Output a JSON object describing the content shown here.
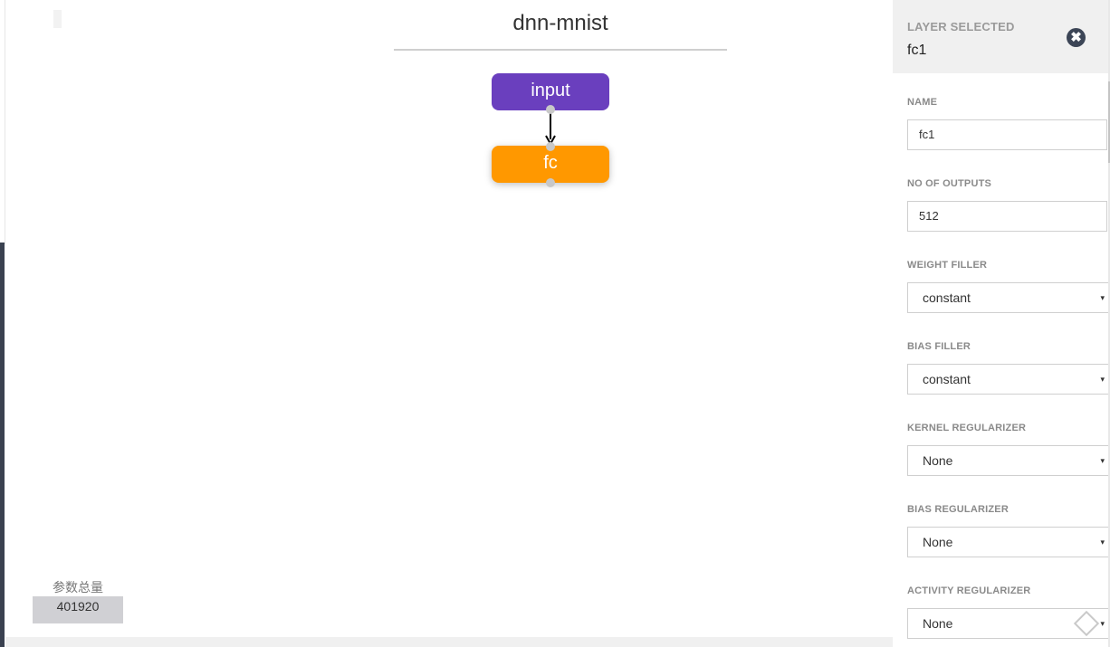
{
  "canvas": {
    "title": "dnn-mnist",
    "nodes": [
      {
        "label": "input",
        "color": "#6a3fbe"
      },
      {
        "label": "fc",
        "color": "#ff9800"
      }
    ],
    "params_label": "参数总量",
    "params_value": "401920"
  },
  "panel": {
    "header_label": "LAYER SELECTED",
    "header_value": "fc1",
    "close_icon": "close-circle-icon",
    "fields": [
      {
        "label": "NAME",
        "value": "fc1",
        "kind": "input"
      },
      {
        "label": "NO OF OUTPUTS",
        "value": "512",
        "kind": "input"
      },
      {
        "label": "WEIGHT FILLER",
        "value": "constant",
        "kind": "select"
      },
      {
        "label": "BIAS FILLER",
        "value": "constant",
        "kind": "select"
      },
      {
        "label": "KERNEL REGULARIZER",
        "value": "None",
        "kind": "select"
      },
      {
        "label": "BIAS REGULARIZER",
        "value": "None",
        "kind": "select"
      },
      {
        "label": "ACTIVITY REGULARIZER",
        "value": "None",
        "kind": "select"
      }
    ],
    "caret": "▾"
  },
  "colors": {
    "accent_dark": "#3c4556",
    "input_node": "#6a3fbe",
    "fc_node": "#ff9800"
  }
}
